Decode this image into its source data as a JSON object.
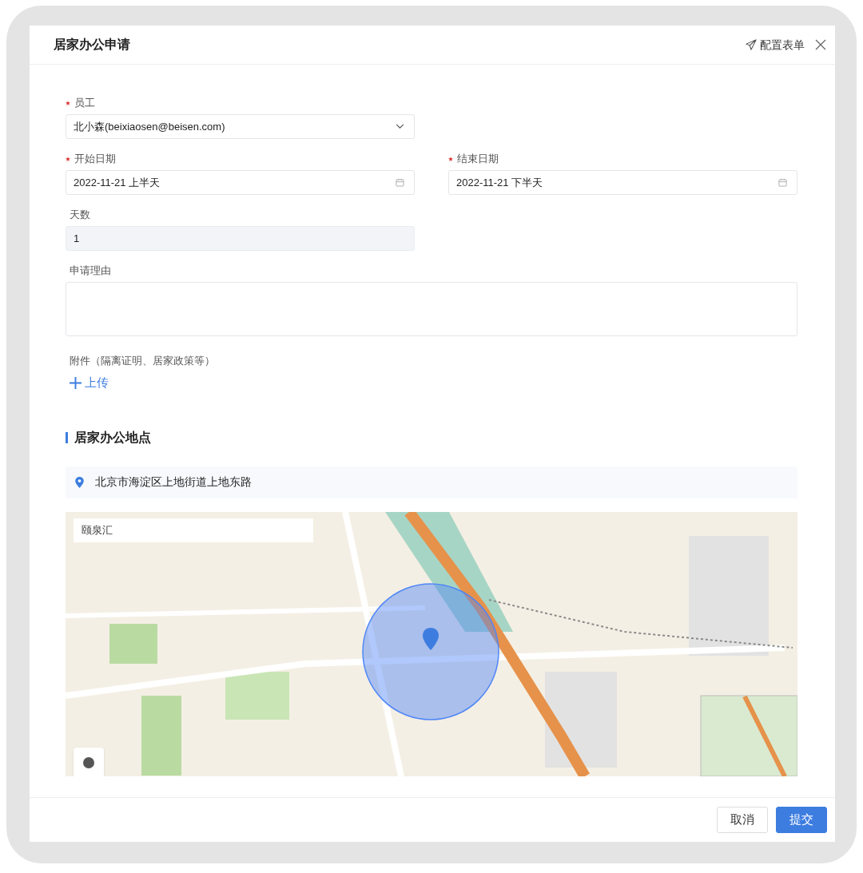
{
  "dialog": {
    "title": "居家办公申请",
    "config_button": "配置表单"
  },
  "fields": [
    {
      "kind": "select",
      "label": "员工",
      "required": true,
      "value": "北小森(beixiaosen@beisen.com)",
      "disabled": false
    },
    {
      "kind": "date",
      "label": "开始日期",
      "required": true,
      "value": "2022-11-21 上半天",
      "disabled": false
    },
    {
      "kind": "date",
      "label": "结束日期",
      "required": true,
      "value": "2022-11-21 下半天",
      "disabled": false
    },
    {
      "kind": "text",
      "label": "天数",
      "required": false,
      "value": "1",
      "disabled": true
    },
    {
      "kind": "textarea",
      "label": "申请理由",
      "required": false,
      "disabled": false
    }
  ],
  "attachment": {
    "label": "附件（隔离证明、居家政策等）",
    "upload_button": "上传"
  },
  "location_section": {
    "title": "居家办公地点",
    "address": "北京市海淀区上地街道上地东路",
    "map_search": "颐泉汇"
  },
  "footer": {
    "buttons": [
      {
        "label": "取消",
        "kind": "secondary"
      },
      {
        "label": "提交",
        "kind": "primary"
      }
    ]
  }
}
